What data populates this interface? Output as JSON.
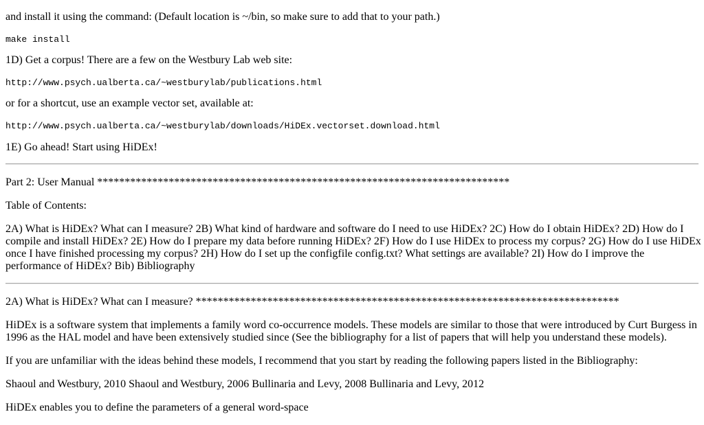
{
  "install_intro": "and install it using the command: (Default location is ~/bin, so make sure to add that to your path.)",
  "install_command": "make install",
  "step_1d": "1D) Get a corpus! There are a few on the Westbury Lab web site:",
  "url_publications": "http://www.psych.ualberta.ca/~westburylab/publications.html",
  "shortcut_text": "or for a shortcut, use an example vector set, available at:",
  "url_vectorset": "http://www.psych.ualberta.ca/~westburylab/downloads/HiDEx.vectorset.download.html",
  "step_1e": "1E) Go ahead! Start using HiDEx!",
  "part2_heading": "Part 2: User Manual ***************************************************************************",
  "toc_heading": "Table of Contents:",
  "toc_lines": [
    "2A) What is HiDEx? What can I measure? 2B) What kind of hardware and software do I need to use HiDEx? 2C) How do I obtain HiDEx? 2D) How do I",
    "compile and install HiDEx? 2E) How do I prepare my data before running HiDEx? 2F) How do I use HiDEx to process my corpus? 2G) How do I use HiDEx",
    "once I have finished processing my corpus? 2H) How do I set up the configfile config.txt? What settings are available? 2I) How do I improve the",
    "performance of HiDEx? Bib) Bibliography"
  ],
  "section_2a_heading": "2A) What is HiDEx? What can I measure? *****************************************************************************",
  "intro_lines": [
    "HiDEx is a software system that implements a family word co-occurrence models. These models are similar to those that were introduced by Curt Burgess in",
    "1996 as the HAL model and have been extensively studied since (See the bibliography for a list of papers that will help you understand these models)."
  ],
  "unfamiliar_text": "If you are unfamiliar with the ideas behind these models, I recommend that you start by reading the following papers listed in the Bibliography:",
  "papers_list": "Shaoul and Westbury, 2010 Shaoul and Westbury, 2006 Bullinaria and Levy, 2008 Bullinaria and Levy, 2012",
  "define_text": "HiDEx enables you to define the parameters of a general word-space"
}
